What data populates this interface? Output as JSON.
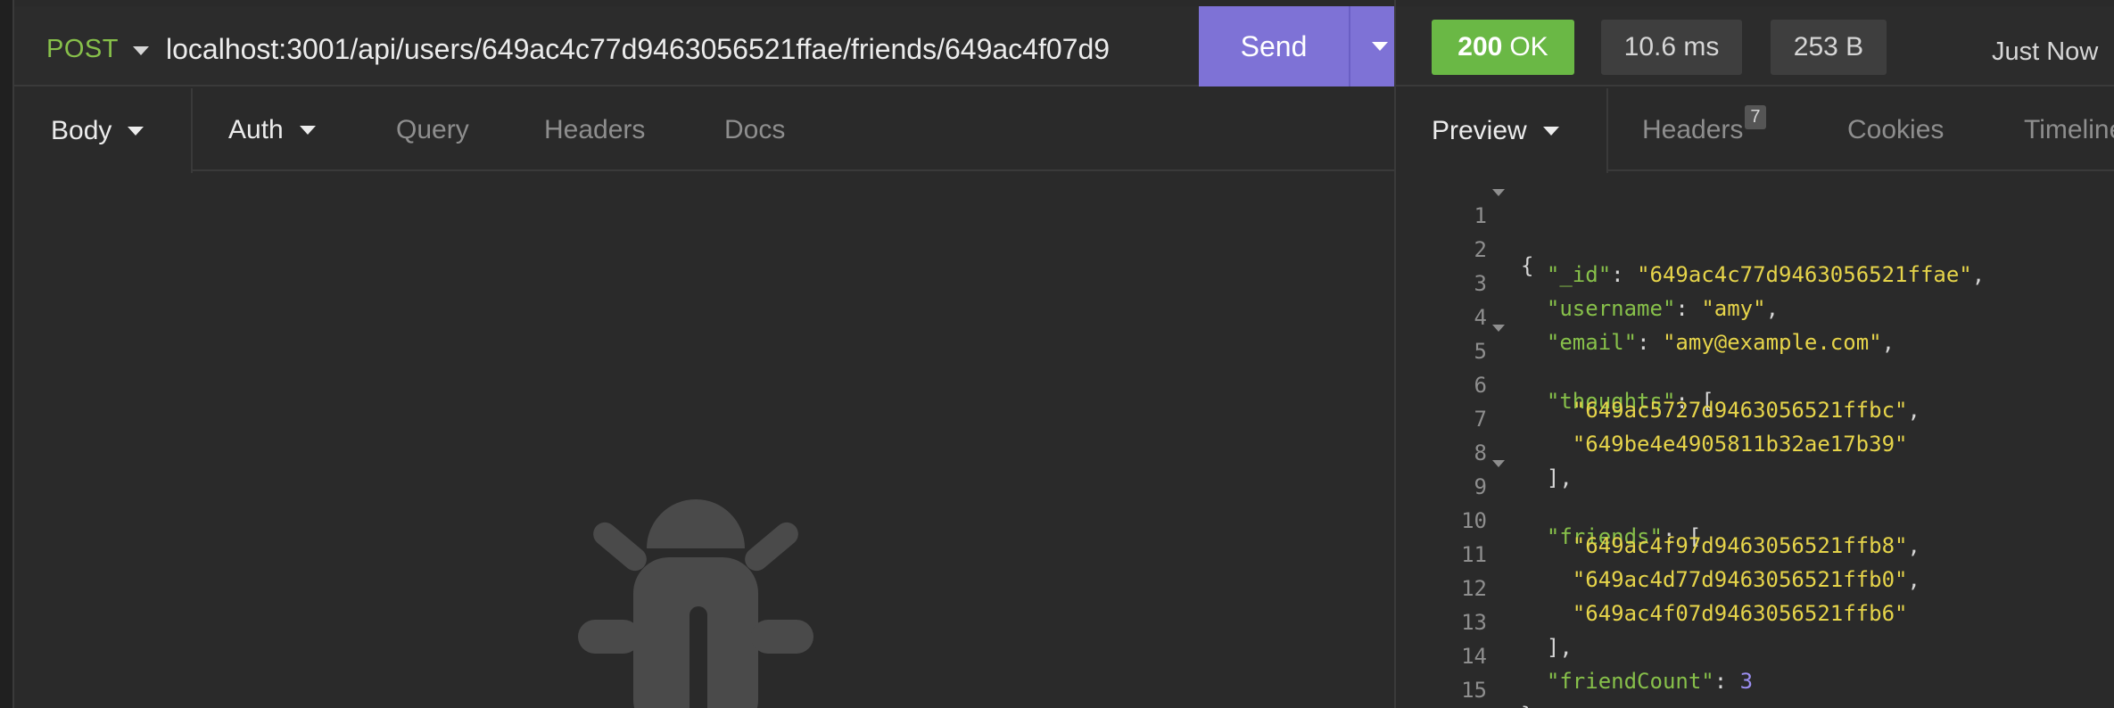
{
  "request": {
    "method": "POST",
    "url": "localhost:3001/api/users/649ac4c77d9463056521ffae/friends/649ac4f07d9",
    "send_label": "Send",
    "tabs": [
      "Body",
      "Auth",
      "Query",
      "Headers",
      "Docs"
    ]
  },
  "response": {
    "status_code": "200",
    "status_text": "OK",
    "time": "10.6 ms",
    "size": "253 B",
    "updated": "Just Now",
    "tabs": {
      "preview": "Preview",
      "headers": "Headers",
      "headers_count": "7",
      "cookies": "Cookies",
      "timeline": "Timeline"
    },
    "body": {
      "id_key": "\"_id\"",
      "id_val": "\"649ac4c77d9463056521ffae\"",
      "username_key": "\"username\"",
      "username_val": "\"amy\"",
      "email_key": "\"email\"",
      "email_val": "\"amy@example.com\"",
      "thoughts_key": "\"thoughts\"",
      "thoughts": [
        "\"649ac5727d9463056521ffbc\"",
        "\"649be4e4905811b32ae17b39\""
      ],
      "friends_key": "\"friends\"",
      "friends": [
        "\"649ac4f97d9463056521ffb8\"",
        "\"649ac4d77d9463056521ffb0\"",
        "\"649ac4f07d9463056521ffb6\""
      ],
      "friendcount_key": "\"friendCount\"",
      "friendcount_val": "3"
    },
    "line_numbers": [
      "1",
      "2",
      "3",
      "4",
      "5",
      "6",
      "7",
      "8",
      "9",
      "10",
      "11",
      "12",
      "13",
      "14",
      "15"
    ]
  },
  "colors": {
    "accent": "#7e72d6",
    "status_ok": "#6ab845",
    "json_key": "#87c04a",
    "json_string": "#e6d44a",
    "json_number": "#9b8ef0"
  },
  "icons": [
    "dropdown-caret-icon",
    "bug-icon",
    "fold-caret-icon"
  ]
}
